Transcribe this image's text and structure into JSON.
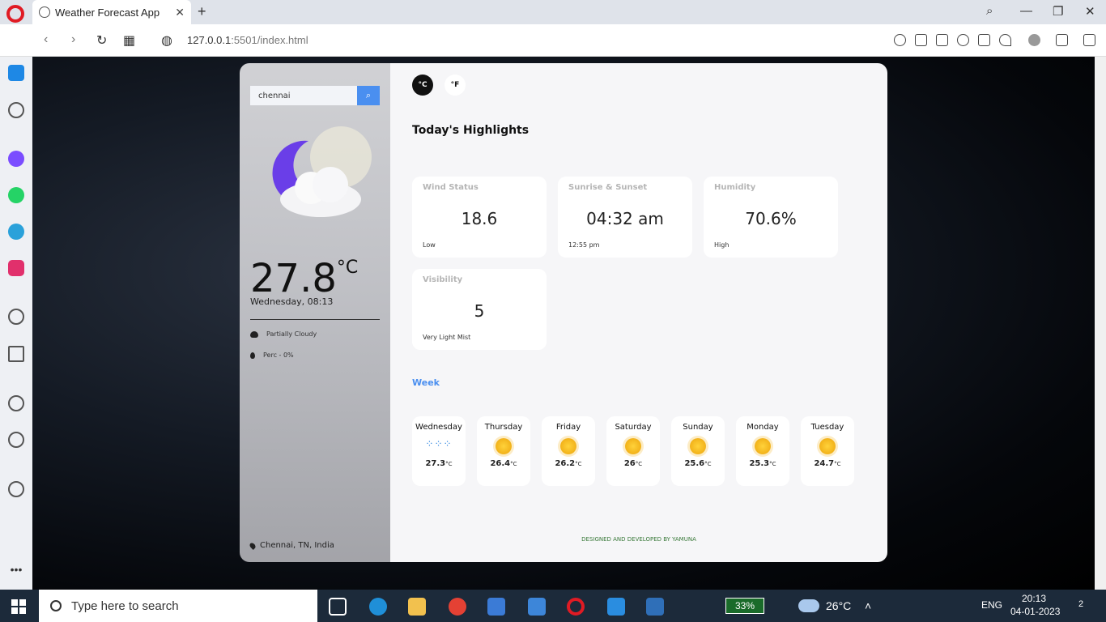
{
  "browser": {
    "tab_title": "Weather Forecast App",
    "url_host": "127.0.0.1",
    "url_rest": ":5501/index.html"
  },
  "app": {
    "search": {
      "value": "chennai",
      "placeholder": ""
    },
    "current": {
      "temp": "27.8",
      "unit": "°C",
      "day_time": "Wednesday, 08:13",
      "condition": "Partially Cloudy",
      "precip": "Perc - 0%",
      "location": "Chennai, TN, India"
    },
    "units": {
      "celsius": "°C",
      "fahrenheit": "°F"
    },
    "highlights": {
      "title": "Today's Highlights",
      "cards": [
        {
          "title": "Wind Status",
          "value": "18.6",
          "sub": "Low"
        },
        {
          "title": "Sunrise & Sunset",
          "value": "04:32 am",
          "sub": "12:55 pm"
        },
        {
          "title": "Humidity",
          "value": "70.6%",
          "sub": "High"
        },
        {
          "title": "Visibility",
          "value": "5",
          "sub": "Very Light Mist"
        }
      ]
    },
    "week": {
      "title": "Week",
      "days": [
        {
          "name": "Wednesday",
          "temp": "27.3",
          "icon": "rain-icon"
        },
        {
          "name": "Thursday",
          "temp": "26.4",
          "icon": "sun-icon"
        },
        {
          "name": "Friday",
          "temp": "26.2",
          "icon": "sun-icon"
        },
        {
          "name": "Saturday",
          "temp": "26",
          "icon": "sun-icon"
        },
        {
          "name": "Sunday",
          "temp": "25.6",
          "icon": "sun-icon"
        },
        {
          "name": "Monday",
          "temp": "25.3",
          "icon": "sun-icon"
        },
        {
          "name": "Tuesday",
          "temp": "24.7",
          "icon": "sun-icon"
        }
      ],
      "unit": "°C"
    },
    "footer": "DESIGNED AND DEVELOPED BY YAMUNA"
  },
  "taskbar": {
    "search_placeholder": "Type here to search",
    "battery": "33%",
    "weather": "26°C",
    "language": "ENG",
    "time": "20:13",
    "date": "04-01-2023",
    "notifications": "2"
  }
}
